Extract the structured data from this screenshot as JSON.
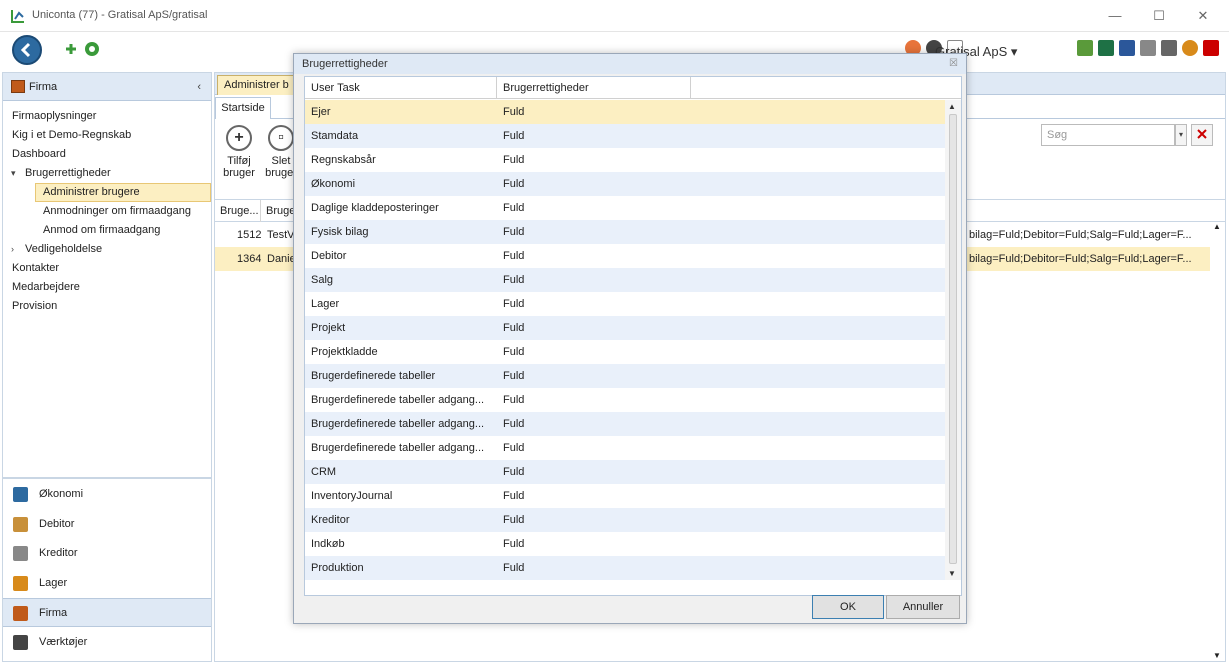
{
  "window": {
    "title": "Uniconta (77)  - Gratisal ApS/gratisal",
    "minimize": "—",
    "maximize": "☐",
    "close": "✕"
  },
  "toolbar": {
    "company": "Gratisal ApS ▾"
  },
  "sidebar": {
    "header": "Firma",
    "collapse": "‹",
    "tree": [
      {
        "label": "Firmaoplysninger",
        "level": 0
      },
      {
        "label": "Kig i et Demo-Regnskab",
        "level": 0
      },
      {
        "label": "Dashboard",
        "level": 0
      },
      {
        "label": "Brugerrettigheder",
        "level": 0,
        "arrow": "▾"
      },
      {
        "label": "Administrer brugere",
        "level": 1,
        "selected": true
      },
      {
        "label": "Anmodninger om firmaadgang",
        "level": 1
      },
      {
        "label": "Anmod om firmaadgang",
        "level": 1
      },
      {
        "label": "Vedligeholdelse",
        "level": 0,
        "arrow": "›"
      },
      {
        "label": "Kontakter",
        "level": 0
      },
      {
        "label": "Medarbejdere",
        "level": 0
      },
      {
        "label": "Provision",
        "level": 0
      }
    ],
    "modules": [
      {
        "label": "Økonomi",
        "color": "#2d6aa0"
      },
      {
        "label": "Debitor",
        "color": "#c8903a"
      },
      {
        "label": "Kreditor",
        "color": "#888888"
      },
      {
        "label": "Lager",
        "color": "#d88a1a"
      },
      {
        "label": "Firma",
        "color": "#c05a1a"
      },
      {
        "label": "Værktøjer",
        "color": "#444444"
      }
    ]
  },
  "main": {
    "tab": "Administrer b",
    "ribbon_tab": "Startside",
    "add_button": "Tilføj bruger",
    "delete_button": "Slet bruger",
    "search_placeholder": "Søg",
    "columns": [
      "Bruge...",
      "Bruge"
    ],
    "rows": [
      {
        "id": "1512",
        "name": "TestV",
        "rights": "bilag=Fuld;Debitor=Fuld;Salg=Fuld;Lager=F..."
      },
      {
        "id": "1364",
        "name": "Danie",
        "rights": "bilag=Fuld;Debitor=Fuld;Salg=Fuld;Lager=F..."
      }
    ]
  },
  "dialog": {
    "title": "Brugerrettigheder",
    "close": "☒",
    "columns": [
      "User Task",
      "Brugerrettigheder"
    ],
    "rows": [
      {
        "task": "Ejer",
        "right": "Fuld"
      },
      {
        "task": "Stamdata",
        "right": "Fuld"
      },
      {
        "task": "Regnskabsår",
        "right": "Fuld"
      },
      {
        "task": "Økonomi",
        "right": "Fuld"
      },
      {
        "task": "Daglige kladdeposteringer",
        "right": "Fuld"
      },
      {
        "task": "Fysisk bilag",
        "right": "Fuld"
      },
      {
        "task": "Debitor",
        "right": "Fuld"
      },
      {
        "task": "Salg",
        "right": "Fuld"
      },
      {
        "task": "Lager",
        "right": "Fuld"
      },
      {
        "task": "Projekt",
        "right": "Fuld"
      },
      {
        "task": "Projektkladde",
        "right": "Fuld"
      },
      {
        "task": "Brugerdefinerede tabeller",
        "right": "Fuld"
      },
      {
        "task": "Brugerdefinerede tabeller adgang...",
        "right": "Fuld"
      },
      {
        "task": "Brugerdefinerede tabeller adgang...",
        "right": "Fuld"
      },
      {
        "task": "Brugerdefinerede tabeller adgang...",
        "right": "Fuld"
      },
      {
        "task": "CRM",
        "right": "Fuld"
      },
      {
        "task": "InventoryJournal",
        "right": "Fuld"
      },
      {
        "task": "Kreditor",
        "right": "Fuld"
      },
      {
        "task": "Indkøb",
        "right": "Fuld"
      },
      {
        "task": "Produktion",
        "right": "Fuld"
      }
    ],
    "ok": "OK",
    "cancel": "Annuller"
  }
}
